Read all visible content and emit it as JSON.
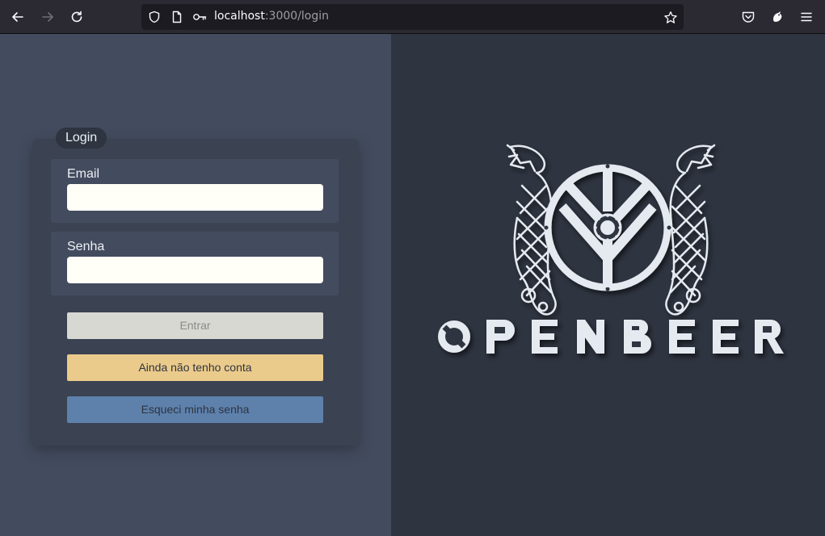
{
  "browser": {
    "url_host": "localhost",
    "url_path": ":3000/login"
  },
  "login": {
    "legend": "Login",
    "email_label": "Email",
    "email_value": "",
    "password_label": "Senha",
    "password_value": "",
    "submit_label": "Entrar",
    "signup_label": "Ainda não tenho conta",
    "forgot_label": "Esqueci minha senha"
  },
  "brand": {
    "letters": [
      "O",
      "P",
      "E",
      "N",
      "B",
      "E",
      "E",
      "R"
    ]
  },
  "colors": {
    "panel_left": "#434c5e",
    "panel_right": "#2e3440",
    "signup_button": "#ebcb8b",
    "forgot_button": "#5e81ac"
  }
}
